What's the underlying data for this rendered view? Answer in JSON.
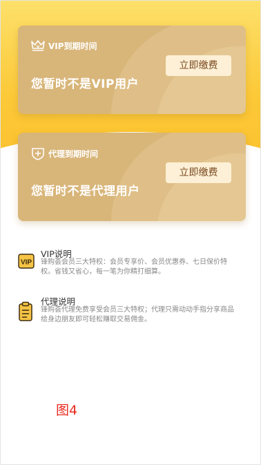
{
  "vip_card": {
    "icon": "crown-icon",
    "header_label": "VIP到期时间",
    "title": "您暂时不是VIP用户",
    "button_label": "立即缴费"
  },
  "agent_card": {
    "icon": "agent-shield-icon",
    "header_label": "代理到期时间",
    "title": "您暂时不是代理用户",
    "button_label": "立即缴费"
  },
  "vip_info": {
    "icon": "vip-badge-icon",
    "icon_text": "VIP",
    "title": "VIP说明",
    "description": "锋购荟会员三大特权：会员专享价、会员优惠券、七日保价特权。省钱又省心，每一笔为你精打细算。"
  },
  "agent_info": {
    "icon": "clipboard-icon",
    "title": "代理说明",
    "description": "锋购荟代理免费享受会员三大特权；代理只需动动手指分享商品给身边朋友即可轻松赚取交易佣金。"
  },
  "figure_label": "图4",
  "colors": {
    "header_yellow": "#fcc938",
    "card_gold": "#d8b579",
    "button_bg": "#fdf0d6",
    "button_text": "#7a4a20",
    "figure_label": "#e8281d"
  }
}
